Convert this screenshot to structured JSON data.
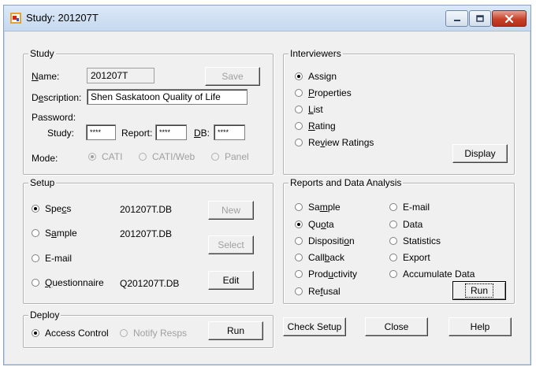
{
  "window": {
    "title": "Study: 201207T"
  },
  "study": {
    "group_title": "Study",
    "name_label": "Name:",
    "name_value": "201207T",
    "save_label": "Save",
    "description_label": "Description:",
    "description_value": "Shen Saskatoon Quality of Life",
    "password_label": "Password:",
    "study_label": "Study:",
    "study_pw": "****",
    "report_label": "Report:",
    "report_pw": "****",
    "db_label": "DB:",
    "db_pw": "****",
    "mode_label": "Mode:",
    "modes": [
      {
        "label": "CATI",
        "checked": true
      },
      {
        "label": "CATI/Web",
        "checked": false
      },
      {
        "label": "Panel",
        "checked": false
      }
    ]
  },
  "interviewers": {
    "group_title": "Interviewers",
    "options": [
      {
        "label": "Assign",
        "checked": true
      },
      {
        "label": "Properties",
        "checked": false
      },
      {
        "label": "List",
        "checked": false
      },
      {
        "label": "Rating",
        "checked": false
      },
      {
        "label": "Review Ratings",
        "checked": false
      }
    ],
    "display_label": "Display"
  },
  "setup": {
    "group_title": "Setup",
    "rows": [
      {
        "label": "Specs",
        "file": "201207T.DB",
        "checked": true
      },
      {
        "label": "Sample",
        "file": "201207T.DB",
        "checked": false
      },
      {
        "label": "E-mail",
        "file": "",
        "checked": false
      },
      {
        "label": "Questionnaire",
        "file": "Q201207T.DB",
        "checked": false
      }
    ],
    "new_label": "New",
    "select_label": "Select",
    "edit_label": "Edit"
  },
  "reports": {
    "group_title": "Reports and Data Analysis",
    "left": [
      {
        "label": "Sample",
        "checked": false
      },
      {
        "label": "Quota",
        "checked": true
      },
      {
        "label": "Disposition",
        "checked": false
      },
      {
        "label": "Callback",
        "checked": false
      },
      {
        "label": "Productivity",
        "checked": false
      },
      {
        "label": "Refusal",
        "checked": false
      }
    ],
    "right": [
      {
        "label": "E-mail",
        "checked": false
      },
      {
        "label": "Data",
        "checked": false
      },
      {
        "label": "Statistics",
        "checked": false
      },
      {
        "label": "Export",
        "checked": false
      },
      {
        "label": "Accumulate Data",
        "checked": false
      }
    ],
    "run_label": "Run"
  },
  "deploy": {
    "group_title": "Deploy",
    "access_control": "Access Control",
    "notify_resps": "Notify Resps",
    "run_label": "Run"
  },
  "footer": {
    "check_setup": "Check Setup",
    "close": "Close",
    "help": "Help"
  }
}
